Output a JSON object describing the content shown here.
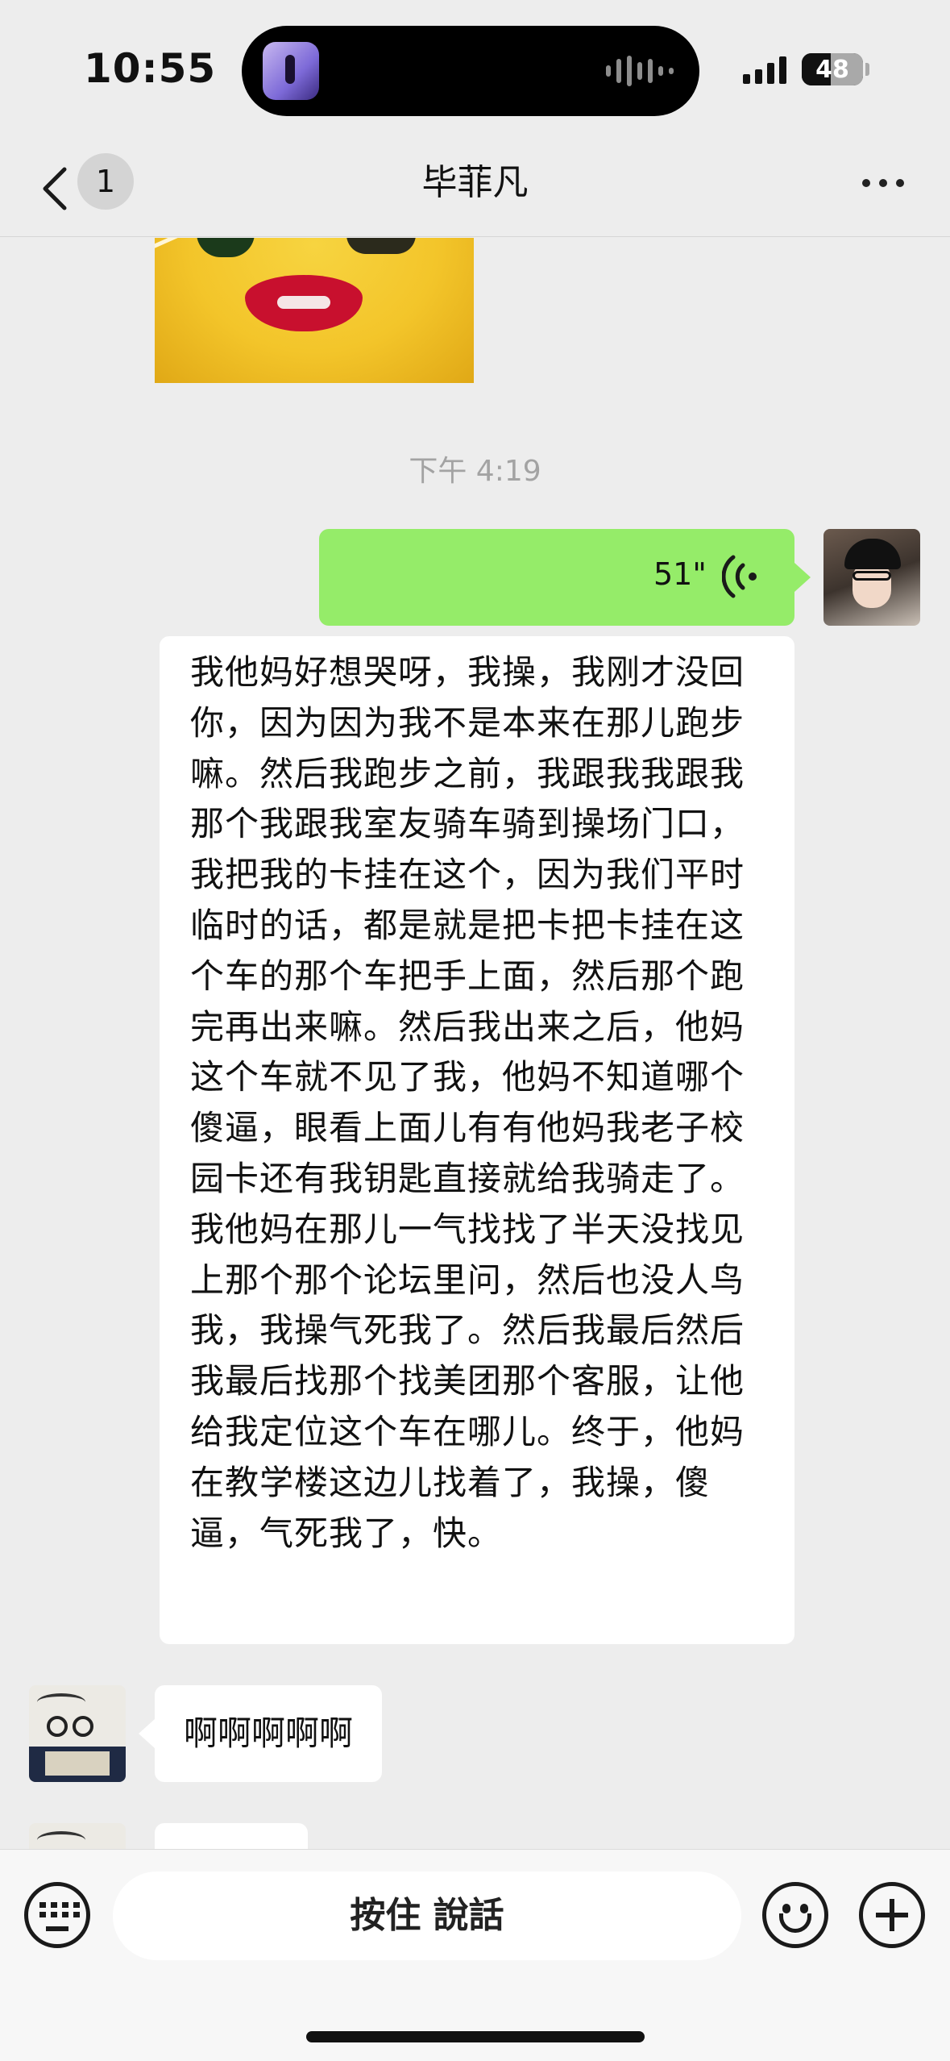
{
  "status_bar": {
    "time": "10:55",
    "battery": "48"
  },
  "nav": {
    "unread_count": "1",
    "title": "毕菲凡"
  },
  "chat": {
    "timestamp": "下午 4:19",
    "voice_message": {
      "duration": "51\"",
      "transcription": "我他妈好想哭呀，我操，我刚才没回你，因为因为我不是本来在那儿跑步嘛。然后我跑步之前，我跟我我跟我那个我跟我室友骑车骑到操场门口，我把我的卡挂在这个，因为我们平时临时的话，都是就是把卡把卡挂在这个车的那个车把手上面，然后那个跑完再出来嘛。然后我出来之后，他妈这个车就不见了我，他妈不知道哪个傻逼，眼看上面儿有有他妈我老子校园卡还有我钥匙直接就给我骑走了。我他妈在那儿一气找找了半天没找见上那个那个论坛里问，然后也没人鸟我，我操气死我了。然后我最后然后我最后找那个找美团那个客服，让他给我定位这个车在哪儿。终于，他妈在教学楼这边儿找着了，我操，傻逼，气死我了，快。"
    },
    "peer_message": "啊啊啊啊啊"
  },
  "input_bar": {
    "hold_to_talk": "按住 說話"
  },
  "colors": {
    "background": "#ededed",
    "self_bubble": "#95ec69",
    "peer_bubble": "#ffffff",
    "timestamp": "#a3a3a3"
  },
  "icons": [
    "back-icon",
    "more-icon",
    "voice-wave-icon",
    "keyboard-icon",
    "emoji-icon",
    "plus-icon"
  ]
}
